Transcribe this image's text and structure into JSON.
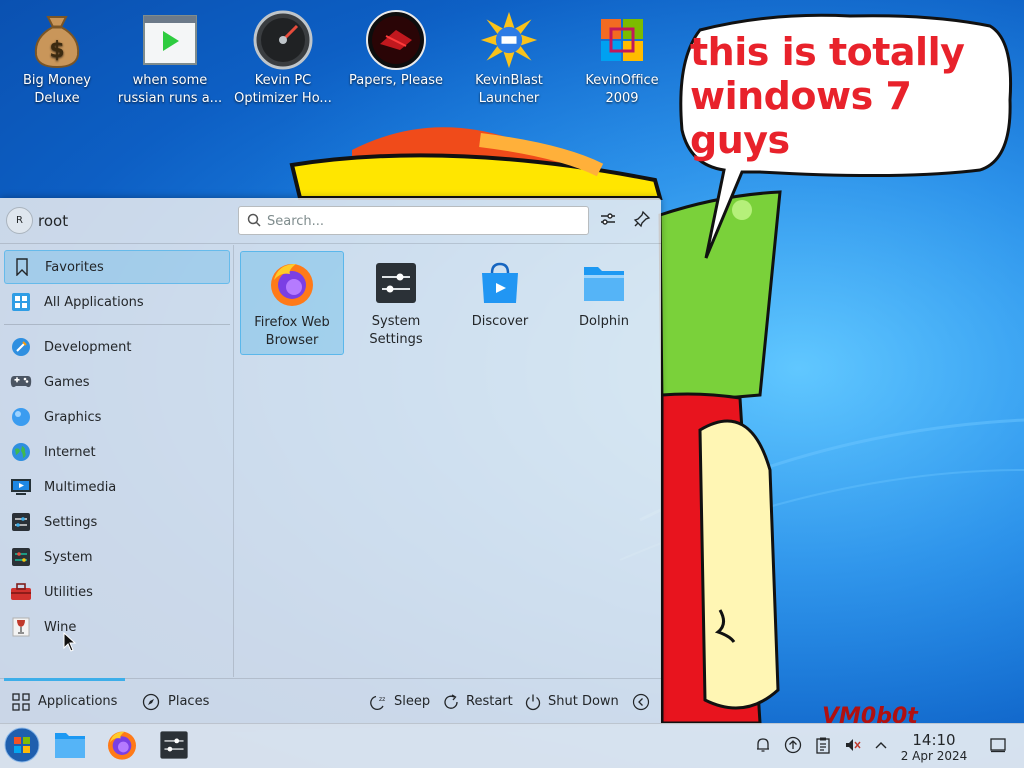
{
  "desktop": {
    "icons": [
      {
        "label": "Big Money\nDeluxe",
        "icon": "money-bag-icon"
      },
      {
        "label": "when some\nrussian runs a...",
        "icon": "video-player-icon"
      },
      {
        "label": "Kevin PC\nOptimizer Ho...",
        "icon": "speedometer-icon"
      },
      {
        "label": "Papers, Please",
        "icon": "papers-please-icon"
      },
      {
        "label": "KevinBlast\nLauncher",
        "icon": "burst-icon"
      },
      {
        "label": "KevinOffice\n2009",
        "icon": "office-icon"
      }
    ],
    "speech_bubble": "this is totally windows 7 guys",
    "signature": "VM0b0t"
  },
  "launcher": {
    "user": {
      "initial": "R",
      "name": "root"
    },
    "search": {
      "placeholder": "Search..."
    },
    "categories": [
      {
        "label": "Favorites",
        "icon": "bookmark-icon",
        "selected": true
      },
      {
        "label": "All Applications",
        "icon": "grid-icon"
      },
      {
        "label": "Development",
        "icon": "development-icon"
      },
      {
        "label": "Games",
        "icon": "gamepad-icon"
      },
      {
        "label": "Graphics",
        "icon": "graphics-icon"
      },
      {
        "label": "Internet",
        "icon": "globe-icon"
      },
      {
        "label": "Multimedia",
        "icon": "multimedia-icon"
      },
      {
        "label": "Settings",
        "icon": "settings-icon"
      },
      {
        "label": "System",
        "icon": "system-icon"
      },
      {
        "label": "Utilities",
        "icon": "toolbox-icon"
      },
      {
        "label": "Wine",
        "icon": "wine-glass-icon"
      }
    ],
    "favorites": [
      {
        "label": "Firefox Web\nBrowser",
        "icon": "firefox-icon",
        "selected": true
      },
      {
        "label": "System\nSettings",
        "icon": "system-settings-icon"
      },
      {
        "label": "Discover",
        "icon": "discover-icon"
      },
      {
        "label": "Dolphin",
        "icon": "folder-icon"
      }
    ],
    "footer": {
      "tabs": [
        {
          "label": "Applications",
          "icon": "applications-icon",
          "active": true
        },
        {
          "label": "Places",
          "icon": "compass-icon"
        }
      ],
      "actions": [
        {
          "label": "Sleep",
          "icon": "sleep-icon"
        },
        {
          "label": "Restart",
          "icon": "restart-icon"
        },
        {
          "label": "Shut Down",
          "icon": "power-icon"
        }
      ]
    }
  },
  "taskbar": {
    "clock": {
      "time": "14:10",
      "date": "2 Apr 2024"
    },
    "accent": "#3daee9"
  }
}
